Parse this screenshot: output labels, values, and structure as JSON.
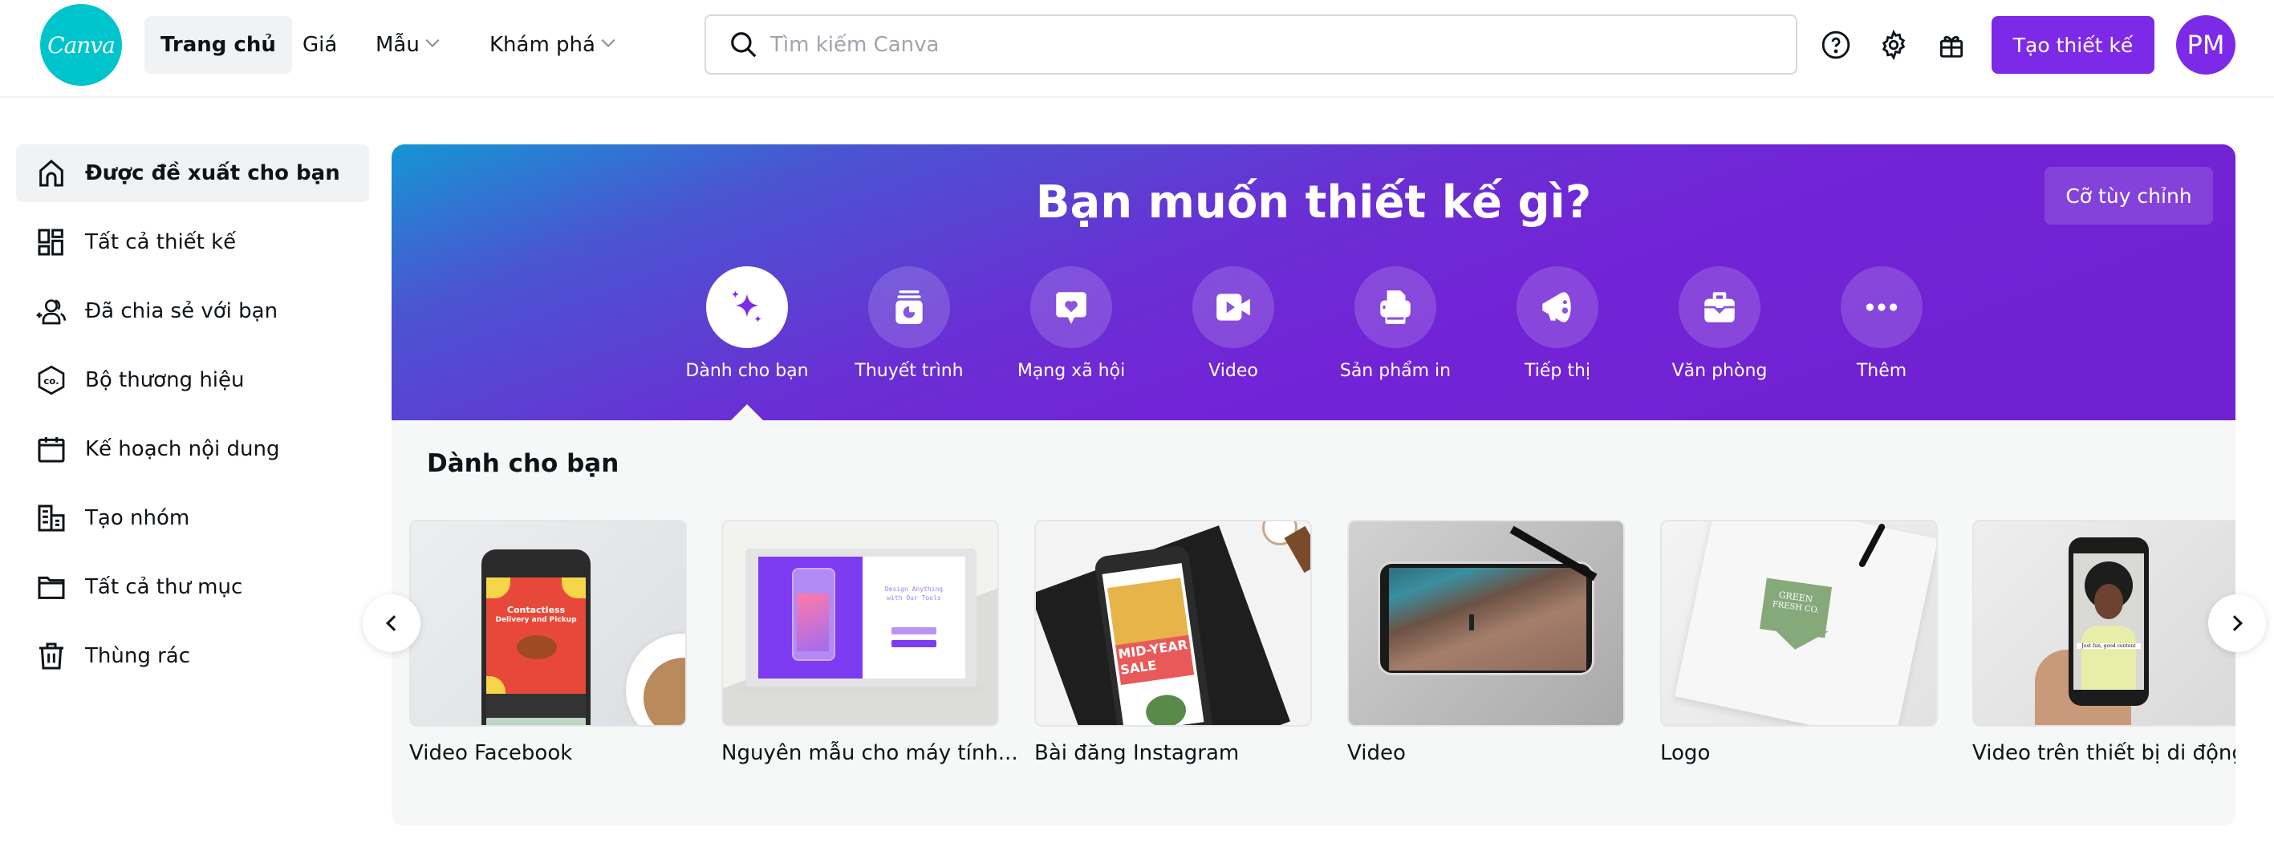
{
  "header": {
    "logo_text": "Canva",
    "nav": [
      {
        "label": "Trang chủ",
        "active": true,
        "has_dropdown": false
      },
      {
        "label": "Giá",
        "active": false,
        "has_dropdown": false
      },
      {
        "label": "Mẫu",
        "active": false,
        "has_dropdown": true
      },
      {
        "label": "Khám phá",
        "active": false,
        "has_dropdown": true
      }
    ],
    "search": {
      "placeholder": "Tìm kiếm Canva",
      "value": ""
    },
    "icons": [
      "help-icon",
      "gear-icon",
      "gift-icon"
    ],
    "create_button": "Tạo thiết kế",
    "avatar_initials": "PM"
  },
  "sidebar": {
    "items": [
      {
        "label": "Được đề xuất cho bạn",
        "icon": "home-icon",
        "active": true
      },
      {
        "label": "Tất cả thiết kế",
        "icon": "grid-icon",
        "active": false
      },
      {
        "label": "Đã chia sẻ với bạn",
        "icon": "shared-users-icon",
        "active": false
      },
      {
        "label": "Bộ thương hiệu",
        "icon": "brand-kit-icon",
        "active": false
      },
      {
        "label": "Kế hoạch nội dung",
        "icon": "calendar-icon",
        "active": false
      },
      {
        "label": "Tạo nhóm",
        "icon": "building-icon",
        "active": false
      },
      {
        "label": "Tất cả thư mục",
        "icon": "folder-icon",
        "active": false
      },
      {
        "label": "Thùng rác",
        "icon": "trash-icon",
        "active": false
      }
    ]
  },
  "hero": {
    "title": "Bạn muốn thiết kế gì?",
    "custom_size_button": "Cỡ tùy chỉnh",
    "categories": [
      {
        "label": "Dành cho bạn",
        "icon": "sparkle-icon",
        "active": true
      },
      {
        "label": "Thuyết trình",
        "icon": "presentation-icon",
        "active": false
      },
      {
        "label": "Mạng xã hội",
        "icon": "social-heart-icon",
        "active": false
      },
      {
        "label": "Video",
        "icon": "video-camera-icon",
        "active": false
      },
      {
        "label": "Sản phẩm in",
        "icon": "printer-icon",
        "active": false
      },
      {
        "label": "Tiếp thị",
        "icon": "megaphone-icon",
        "active": false
      },
      {
        "label": "Văn phòng",
        "icon": "briefcase-icon",
        "active": false
      },
      {
        "label": "Thêm",
        "icon": "more-dots-icon",
        "active": false
      }
    ]
  },
  "for_you": {
    "title": "Dành cho bạn",
    "cards": [
      {
        "label": "Video Facebook",
        "thumb_text": [
          "Contactless",
          "Delivery and Pickup"
        ]
      },
      {
        "label": "Nguyên mẫu cho máy tính...",
        "thumb_text": [
          "Design Anything",
          "with Our Tools"
        ]
      },
      {
        "label": "Bài đăng Instagram",
        "thumb_text": [
          "MID-YEAR",
          "SALE"
        ]
      },
      {
        "label": "Video",
        "thumb_text": []
      },
      {
        "label": "Logo",
        "thumb_text": [
          "GREEN",
          "FRESH CO."
        ]
      },
      {
        "label": "Video trên thiết bị di động",
        "thumb_text": [
          "Just fun, good content"
        ]
      }
    ],
    "prev_arrow": "chevron-left-icon",
    "next_arrow": "chevron-right-icon"
  },
  "colors": {
    "brand_teal": "#00c4cc",
    "brand_purple": "#7d2ae8",
    "hero_gradient_start": "#1596d3",
    "hero_gradient_end": "#6e22d0",
    "panel_bg": "#f6f7f7"
  }
}
